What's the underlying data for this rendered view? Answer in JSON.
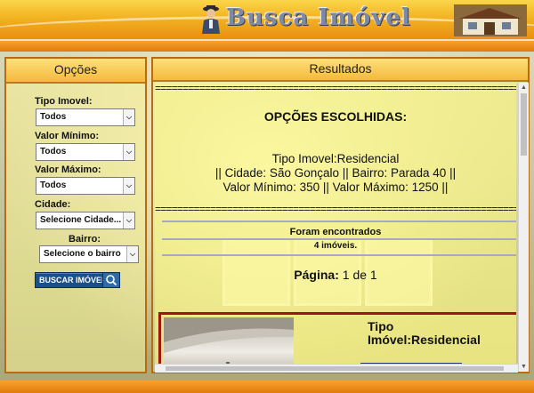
{
  "header": {
    "logo_text": "Busca Imóvel",
    "logo_icon": "person-icon",
    "house_icon": "house-icon"
  },
  "sidebar": {
    "title": "Opções",
    "fields": [
      {
        "label": "Tipo Imovel:",
        "value": "Todos"
      },
      {
        "label": "Valor Mínimo:",
        "value": "Todos"
      },
      {
        "label": "Valor Máximo:",
        "value": "Todos"
      },
      {
        "label": "Cidade:",
        "value": "Selecione Cidade..."
      },
      {
        "label": "Bairro:",
        "value": "Selecione o bairro"
      }
    ],
    "search_button": "BUSCAR IMÓVEIS",
    "search_icon": "magnifier-icon"
  },
  "results": {
    "title": "Resultados",
    "separator": "==================================================================",
    "options_heading": "OPÇÕES ESCOLHIDAS:",
    "options_line1": "Tipo Imovel:Residencial",
    "options_line2": "|| Cidade: São Gonçalo || Bairro: Parada 40 ||",
    "options_line3": "Valor Mínimo: 350 || Valor Máximo: 1250 ||",
    "found_line1": "Foram encontrados",
    "found_line2": "4 imóveis.",
    "page_label": "Página:",
    "page_value": "1 de 1",
    "card": {
      "title_line1": "Tipo",
      "title_line2": "Imóvel:Residencial"
    }
  },
  "colors": {
    "header_orange": "#f2b321",
    "panel_border": "#b96a12",
    "card_border": "#9e1515",
    "button_blue": "#1b4f8a"
  }
}
